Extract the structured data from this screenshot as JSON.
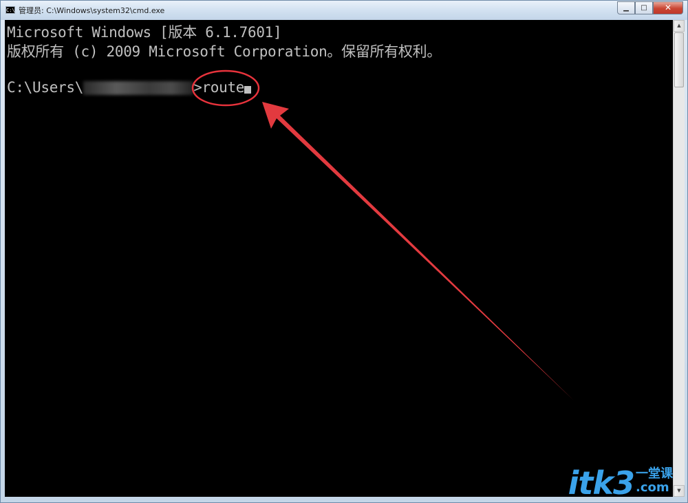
{
  "window": {
    "title": "管理员: C:\\Windows\\system32\\cmd.exe",
    "icon": "cmd-icon",
    "buttons": {
      "minimize": "▁",
      "maximize": "□",
      "close": "✕"
    }
  },
  "console": {
    "lines": [
      "Microsoft Windows [版本 6.1.7601]",
      "版权所有 (c) 2009 Microsoft Corporation。保留所有权利。",
      ""
    ],
    "prompt_prefix": "C:\\Users\\",
    "prompt_suffix": ">",
    "command": "route"
  },
  "annotation": {
    "color": "#e8333c",
    "arrow_color": "#e23a3f"
  },
  "watermark": {
    "main": "itk3",
    "side_top": "一堂课",
    "side_bottom": ".com",
    "color": "#3aa2ea"
  }
}
